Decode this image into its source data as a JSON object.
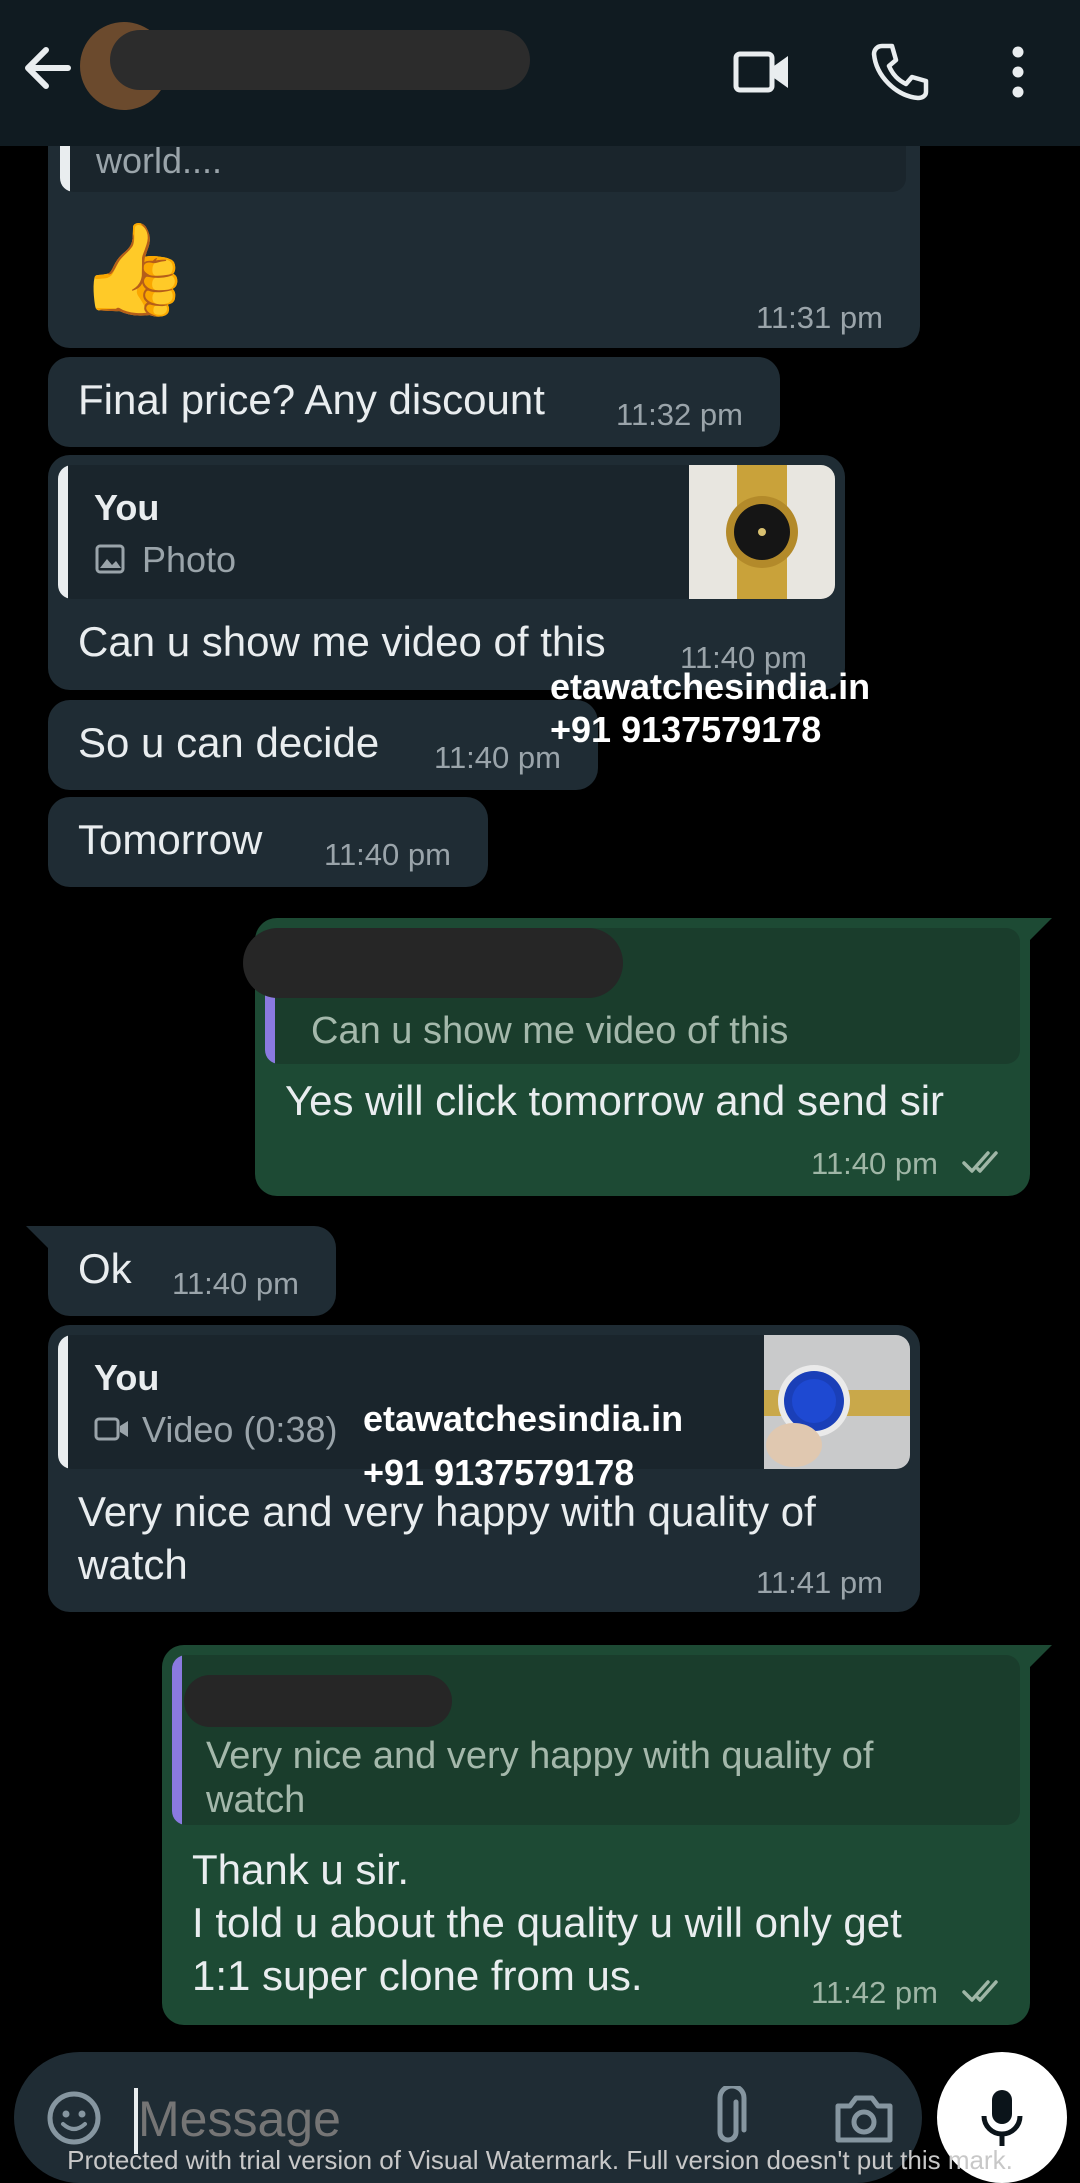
{
  "messages": {
    "m1": {
      "quote_text": "world....",
      "emoji": "👍",
      "time": "11:31 pm"
    },
    "m2": {
      "text": "Final price? Any discount",
      "time": "11:32 pm"
    },
    "m3": {
      "quote_name": "You",
      "quote_type": "Photo",
      "text": "Can u show me video of this",
      "time": "11:40 pm"
    },
    "m4": {
      "text": "So u can decide",
      "time": "11:40 pm"
    },
    "m5": {
      "text": "Tomorrow",
      "time": "11:40 pm"
    },
    "m6": {
      "quote_text": "Can u show me video of this",
      "text": "Yes will click tomorrow and send sir",
      "time": "11:40 pm"
    },
    "m7": {
      "text": "Ok",
      "time": "11:40 pm"
    },
    "m8": {
      "quote_name": "You",
      "quote_type": "Video (0:38)",
      "text_line1": "Very nice and very happy with quality of",
      "text_line2": "watch",
      "time": "11:41 pm"
    },
    "m9": {
      "quote_line1": "Very nice and very happy with quality of",
      "quote_line2": "watch",
      "line1": "Thank u sir.",
      "line2": "I told u about the quality u will only get",
      "line3": "1:1 super clone from us.",
      "time": "11:42 pm"
    }
  },
  "watermark": {
    "site": "etawatchesindia.in",
    "phone": "+91 9137579178"
  },
  "input": {
    "placeholder": "Message"
  },
  "footer": {
    "note": "Protected with trial version of Visual Watermark. Full version doesn't put this mark."
  },
  "colors": {
    "header_bg": "#101b21",
    "incoming_bubble": "#1f2c34",
    "outgoing_bubble": "#1d4a34",
    "accent_bar": "#8a7ae0"
  }
}
